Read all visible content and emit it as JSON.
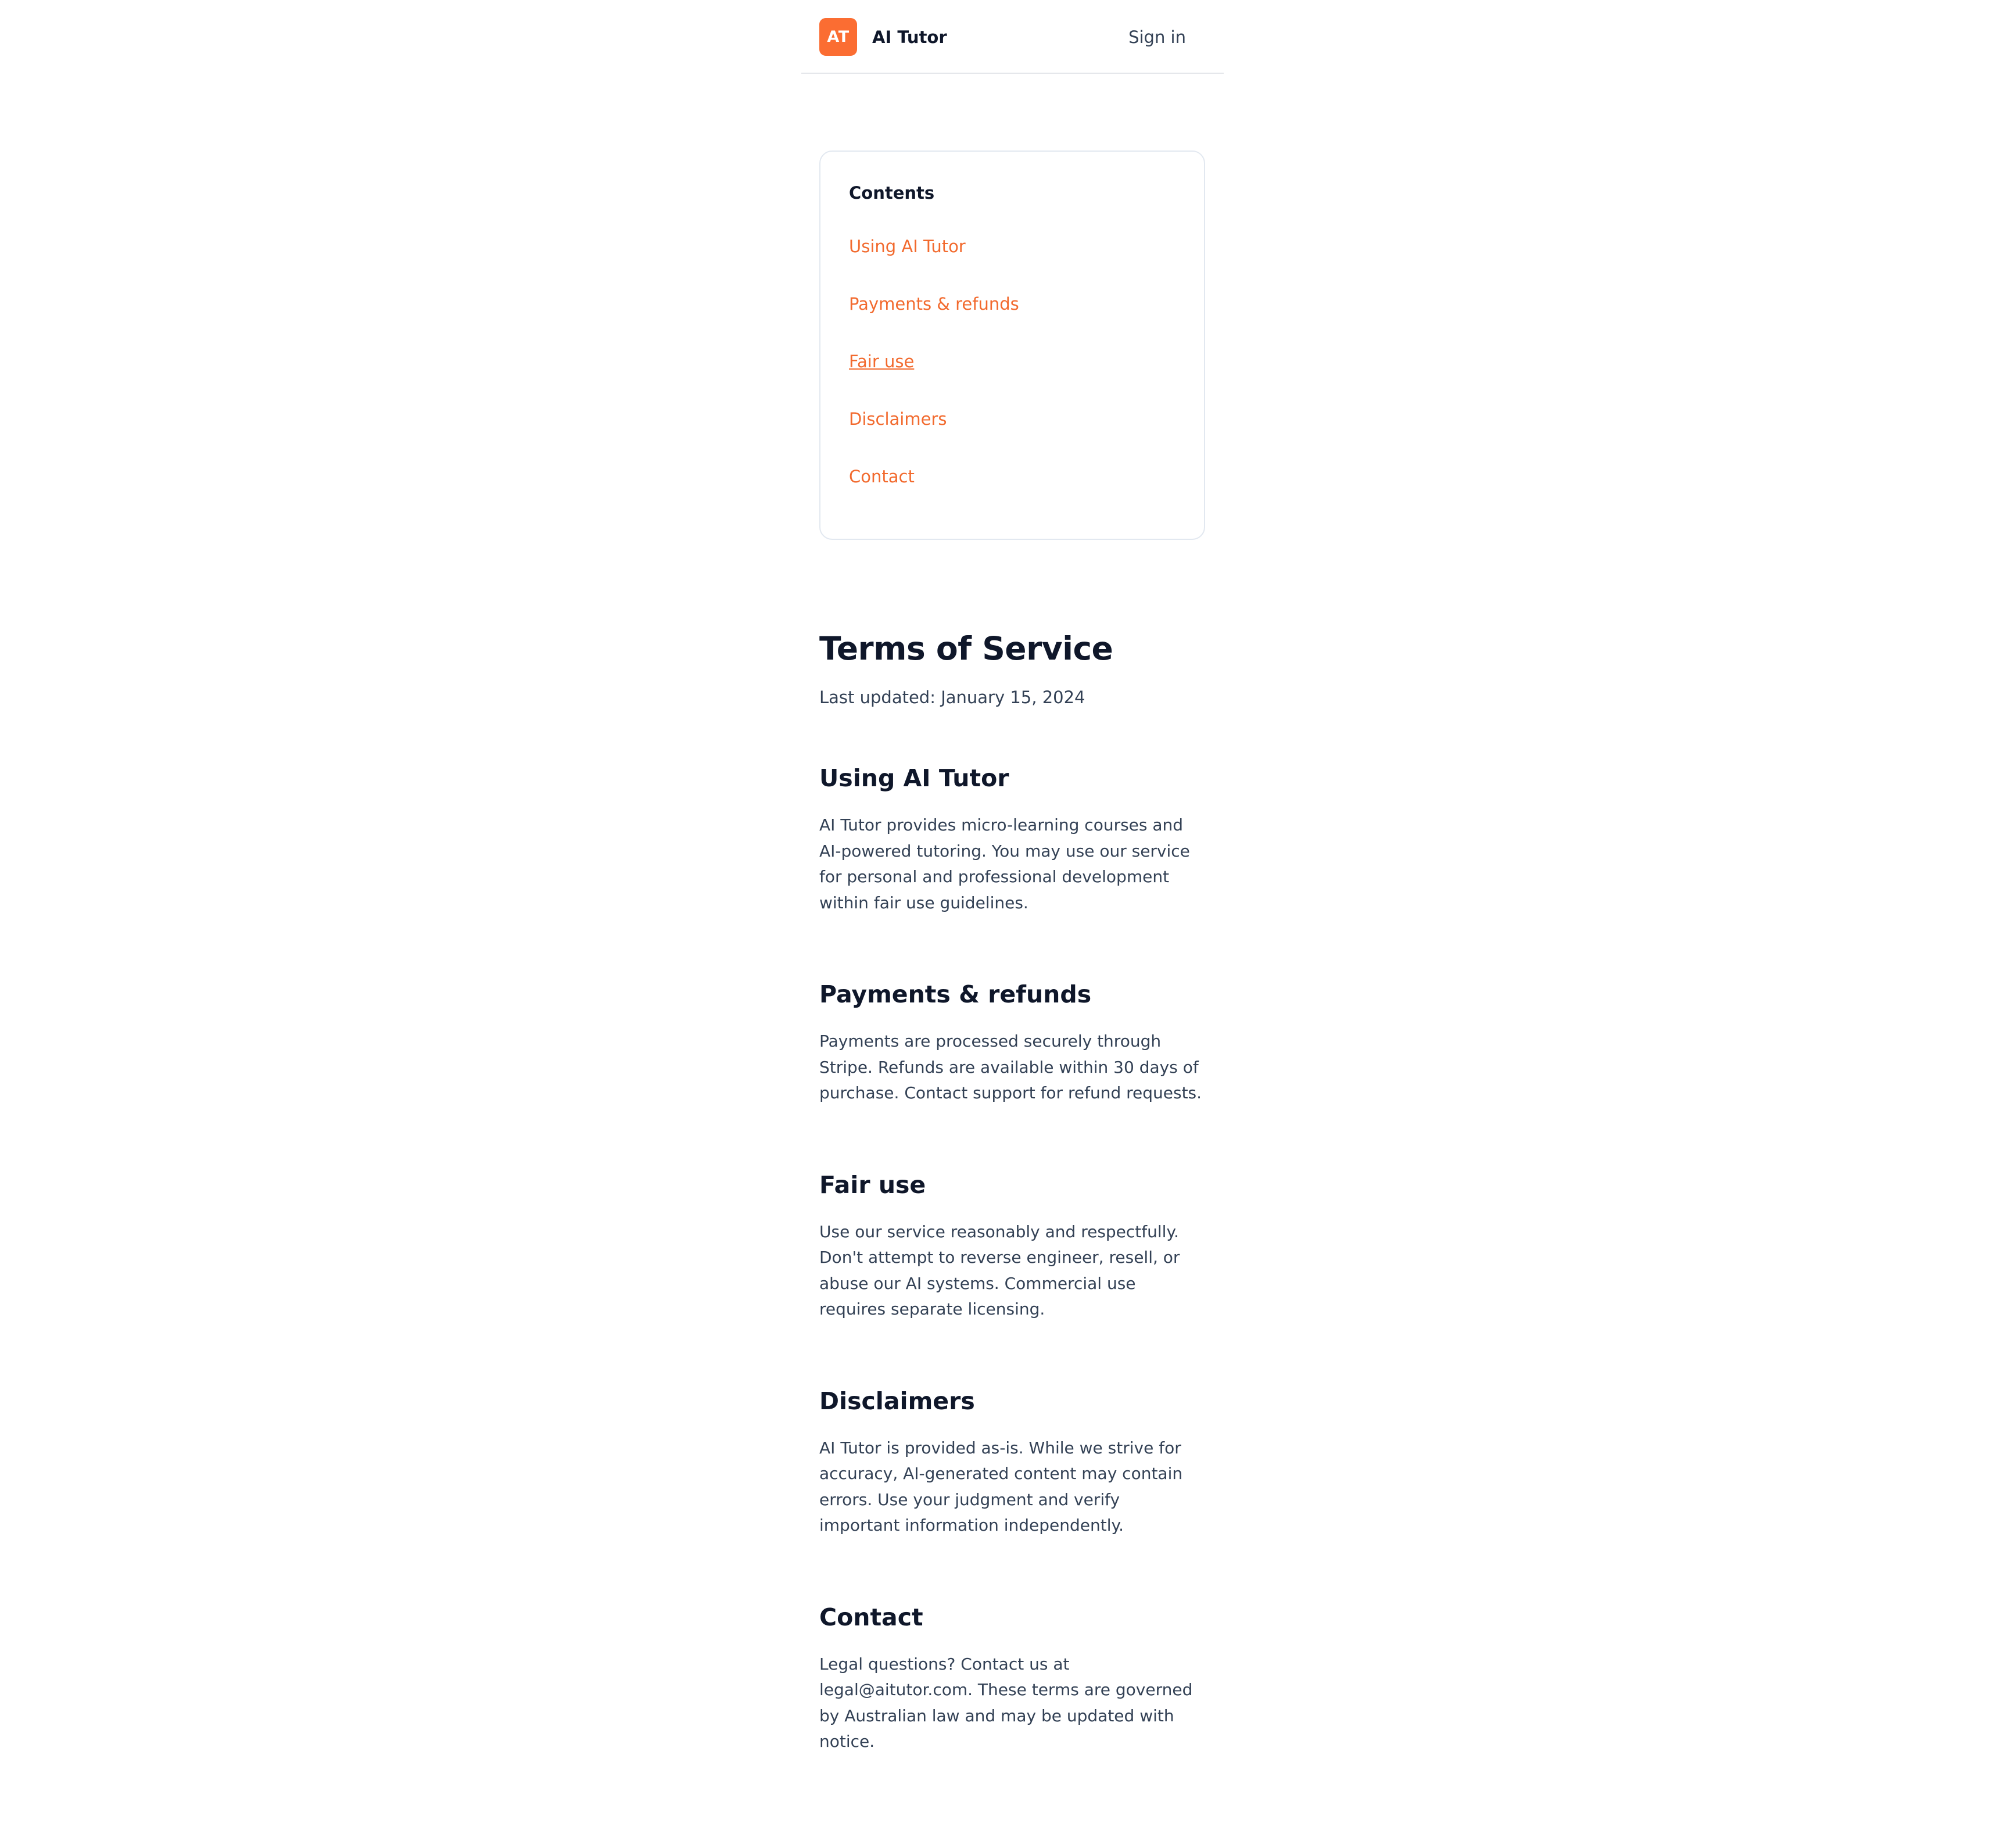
{
  "colors": {
    "accent": "#f26a2e",
    "logo_bg": "#fb6d32",
    "heading": "#0f172a",
    "body_text": "#334155",
    "border": "#e2e8f0"
  },
  "header": {
    "logo_text": "AT",
    "brand_name": "AI Tutor",
    "sign_in": "Sign in"
  },
  "toc": {
    "title": "Contents",
    "items": [
      {
        "label": "Using AI Tutor"
      },
      {
        "label": "Payments & refunds"
      },
      {
        "label": "Fair use",
        "active": true
      },
      {
        "label": "Disclaimers"
      },
      {
        "label": "Contact"
      }
    ]
  },
  "article": {
    "title": "Terms of Service",
    "last_updated": "Last updated: January 15, 2024",
    "sections": [
      {
        "heading": "Using AI Tutor",
        "body": "AI Tutor provides micro-learning courses and AI-powered tutoring. You may use our service for personal and professional development within fair use guidelines."
      },
      {
        "heading": "Payments & refunds",
        "body": "Payments are processed securely through Stripe. Refunds are available within 30 days of purchase. Contact support for refund requests."
      },
      {
        "heading": "Fair use",
        "body": "Use our service reasonably and respectfully. Don't attempt to reverse engineer, resell, or abuse our AI systems. Commercial use requires separate licensing."
      },
      {
        "heading": "Disclaimers",
        "body": "AI Tutor is provided as-is. While we strive for accuracy, AI-generated content may contain errors. Use your judgment and verify important information independently."
      },
      {
        "heading": "Contact",
        "body": "Legal questions? Contact us at legal@aitutor.com. These terms are governed by Australian law and may be updated with notice."
      }
    ]
  }
}
